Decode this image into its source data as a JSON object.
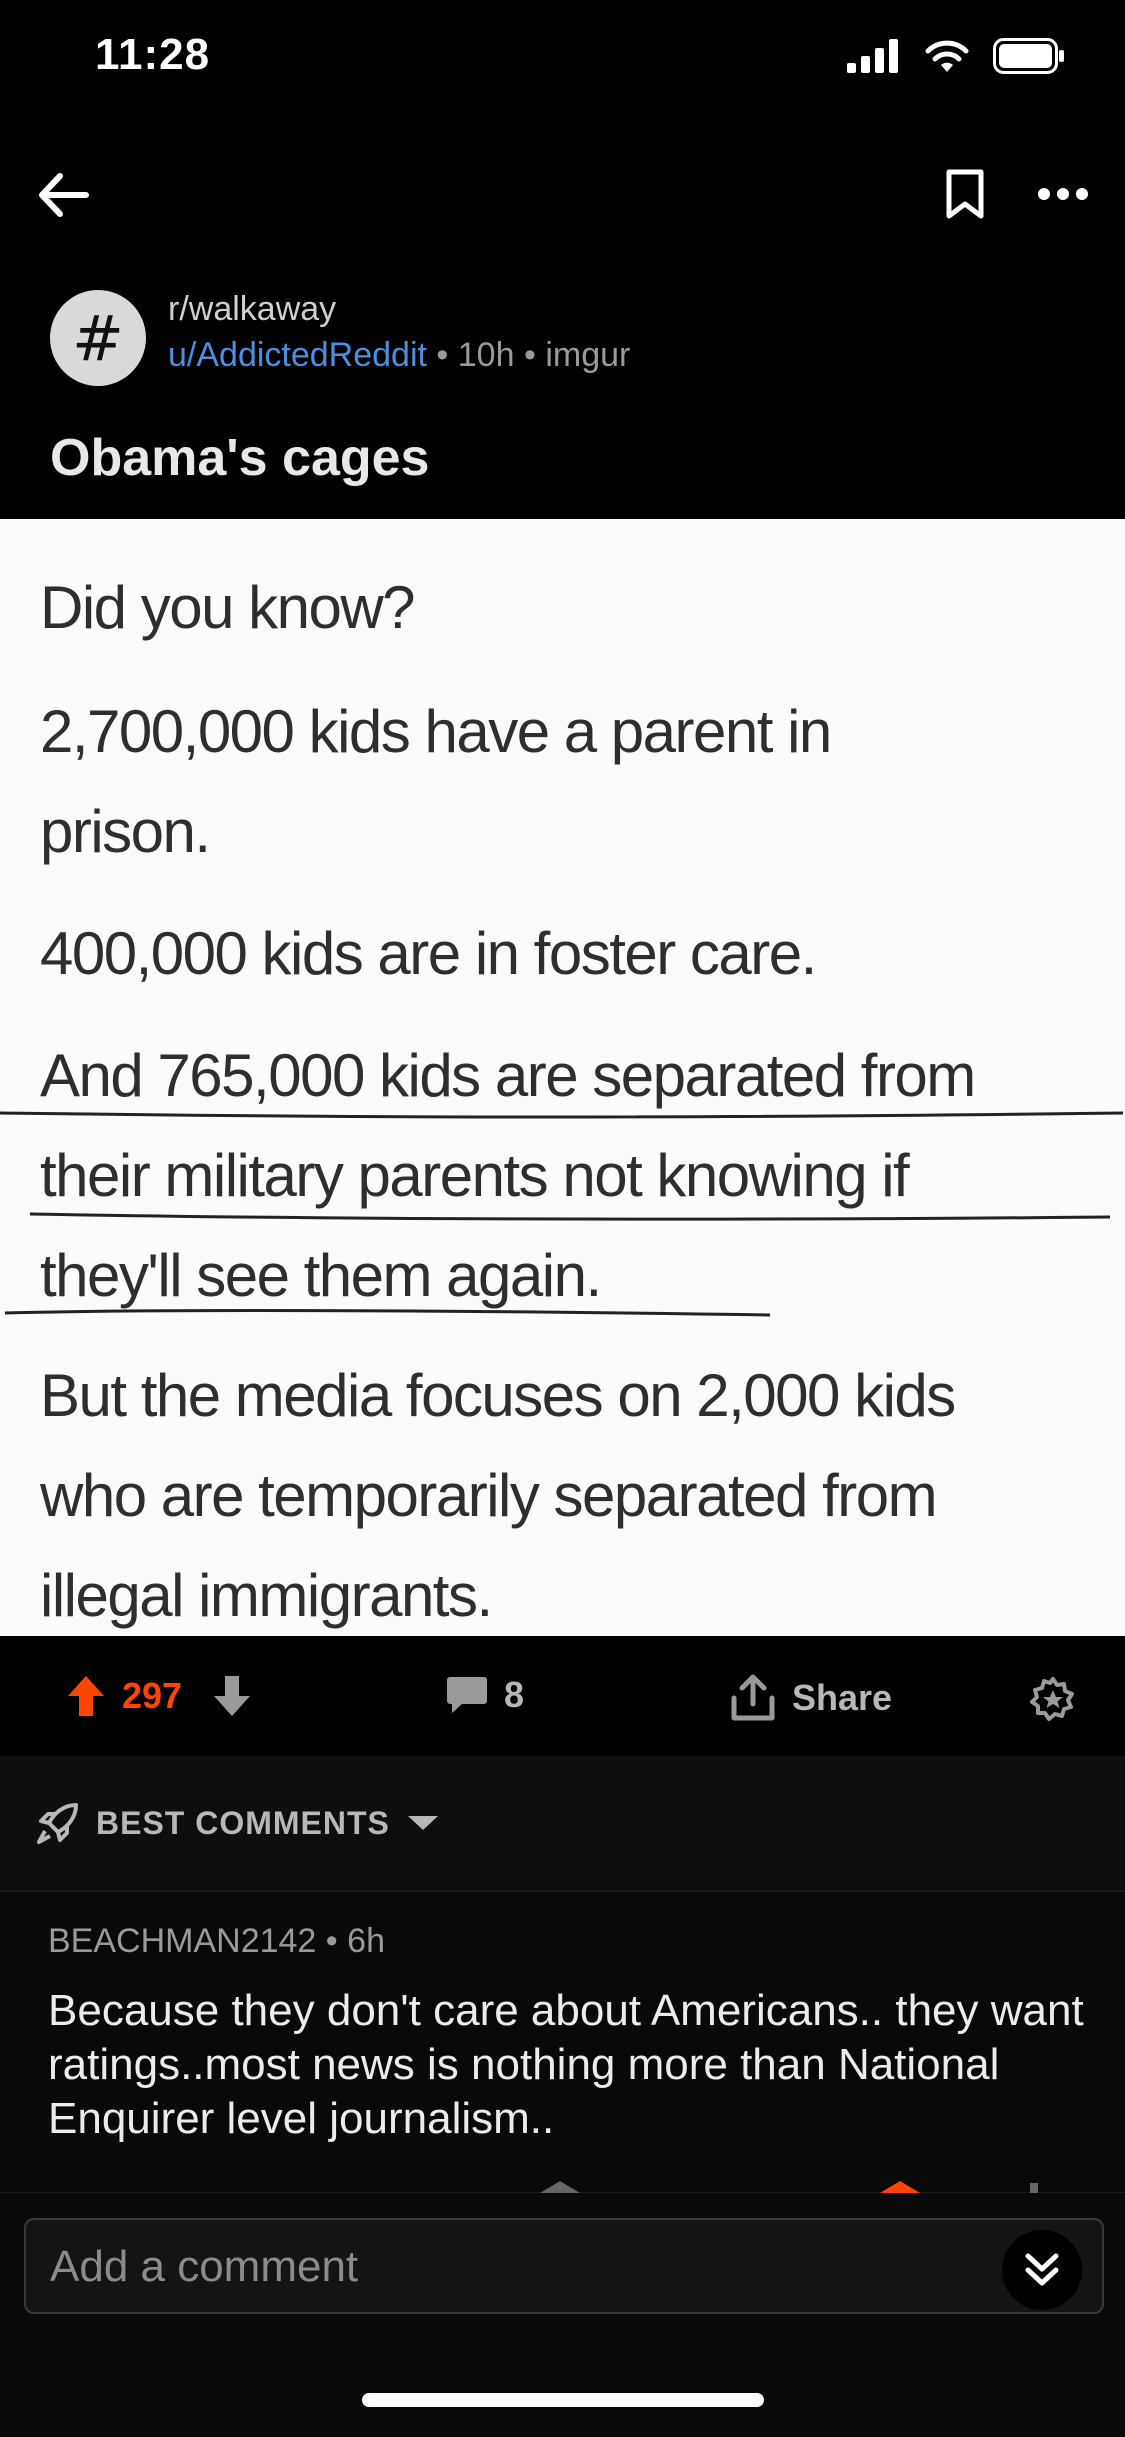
{
  "status_bar": {
    "time": "11:28"
  },
  "post": {
    "subreddit": "r/walkaway",
    "author": "u/AddictedReddit",
    "age": "10h",
    "source": "imgur",
    "separator": "•",
    "title": "Obama's cages",
    "image_text": {
      "line1": "Did you know?",
      "line2": "2,700,000 kids have a parent in",
      "line3": "prison.",
      "line4": "400,000 kids are in foster care.",
      "line5": "And 765,000 kids are separated from",
      "line6": "their military parents not knowing if",
      "line7": "they'll see them again.",
      "line8": "But the media focuses on 2,000 kids",
      "line9": "who are temporarily separated from",
      "line10": "illegal immigrants."
    }
  },
  "actions": {
    "votes": "297",
    "comments": "8",
    "share_label": "Share",
    "accent": "#ff4500"
  },
  "comments": {
    "sort_label": "BEST COMMENTS",
    "items": [
      {
        "author": "BEACHMAN2142",
        "age": "6h",
        "body": "Because they don't care about Americans.. they want ratings..most news is nothing more than National Enquirer level journalism.."
      }
    ]
  },
  "composer": {
    "placeholder": "Add a comment"
  }
}
